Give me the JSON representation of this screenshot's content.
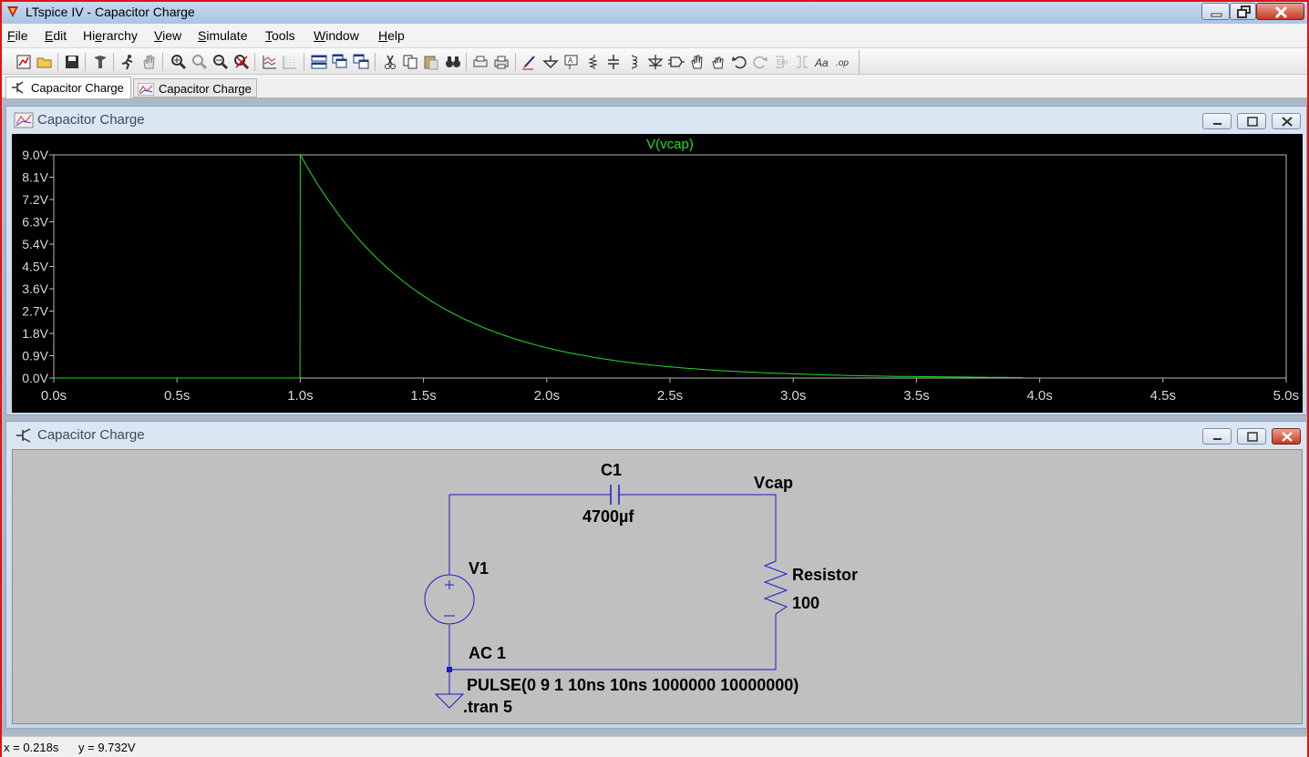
{
  "window": {
    "title": "LTspice IV - Capacitor Charge"
  },
  "menu": [
    {
      "pre": "",
      "u": "F",
      "post": "ile"
    },
    {
      "pre": "",
      "u": "E",
      "post": "dit"
    },
    {
      "pre": "Hi",
      "u": "e",
      "post": "rarchy"
    },
    {
      "pre": "",
      "u": "V",
      "post": "iew"
    },
    {
      "pre": "",
      "u": "S",
      "post": "imulate"
    },
    {
      "pre": "",
      "u": "T",
      "post": "ools"
    },
    {
      "pre": "",
      "u": "W",
      "post": "indow"
    },
    {
      "pre": "",
      "u": "H",
      "post": "elp"
    }
  ],
  "toolbar": {
    "icons": [
      "new-schematic-icon",
      "open-icon",
      "save-icon",
      "control-panel-icon",
      "run-icon",
      "halt-icon",
      "zoom-in-icon",
      "zoom-out-icon",
      "zoom-back-icon",
      "zoom-full-icon",
      "autorange-icon",
      "grid-icon",
      "tile-horizontal-icon",
      "cascade-icon",
      "tile-vertical-icon",
      "cut-icon",
      "copy-icon",
      "paste-icon",
      "find-icon",
      "print-setup-icon",
      "print-icon",
      "wire-icon",
      "ground-icon",
      "label-net-icon",
      "resistor-icon",
      "capacitor-icon",
      "inductor-icon",
      "diode-icon",
      "component-icon",
      "move-icon",
      "drag-icon",
      "undo-icon",
      "redo-icon",
      "rotate-icon",
      "mirror-icon",
      "text-icon",
      "spice-directive-icon"
    ]
  },
  "tabs": [
    {
      "label": "Capacitor Charge",
      "kind": "schematic"
    },
    {
      "label": "Capacitor Charge",
      "kind": "waveform"
    }
  ],
  "waveform_window": {
    "title": "Capacitor Charge"
  },
  "schematic_window": {
    "title": "Capacitor Charge"
  },
  "chart_data": {
    "type": "line",
    "title": "",
    "xlabel": "",
    "ylabel": "",
    "xlim": [
      0,
      5
    ],
    "ylim": [
      0,
      9
    ],
    "x_ticks": [
      "0.0s",
      "0.5s",
      "1.0s",
      "1.5s",
      "2.0s",
      "2.5s",
      "3.0s",
      "3.5s",
      "4.0s",
      "4.5s",
      "5.0s"
    ],
    "y_ticks": [
      "9.0V",
      "8.1V",
      "7.2V",
      "6.3V",
      "5.4V",
      "4.5V",
      "3.6V",
      "2.7V",
      "1.8V",
      "0.9V",
      "0.0V"
    ],
    "grid": false,
    "background": "#000000",
    "axis_color": "#b8b8b8",
    "series": [
      {
        "name": "V(vcap)",
        "color": "#22dd22",
        "x": [
          0,
          0.999,
          1.0,
          1.1,
          1.2,
          1.3,
          1.4,
          1.5,
          1.6,
          1.7,
          1.8,
          1.9,
          2.0,
          2.2,
          2.4,
          2.6,
          2.8,
          3.0,
          3.2,
          3.4,
          3.6,
          3.8,
          3.93
        ],
        "values": [
          0,
          0,
          9.0,
          7.37,
          6.03,
          4.94,
          4.04,
          3.31,
          2.71,
          2.22,
          1.82,
          1.49,
          1.22,
          0.82,
          0.55,
          0.37,
          0.25,
          0.17,
          0.11,
          0.07,
          0.05,
          0.03,
          0.02
        ]
      }
    ]
  },
  "schematic": {
    "capacitor": {
      "name": "C1",
      "value": "4700µf"
    },
    "node_label": "Vcap",
    "resistor": {
      "name": "Resistor",
      "value": "100"
    },
    "source": {
      "name": "V1",
      "value": "AC 1",
      "pulse": "PULSE(0 9 1 10ns 10ns 1000000 10000000)"
    },
    "directive": ".tran 5",
    "wire_color": "#1a1ac8",
    "text_color": "#000000"
  },
  "status": {
    "x": "x = 0.218s",
    "y": "y = 9.732V"
  }
}
